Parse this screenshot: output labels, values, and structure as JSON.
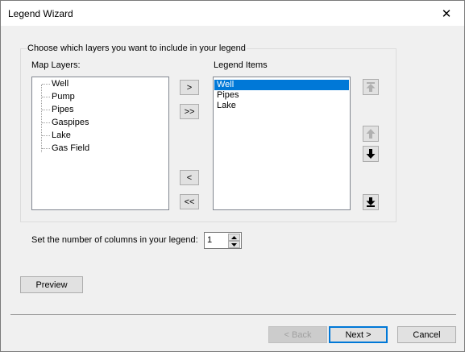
{
  "window": {
    "title": "Legend Wizard"
  },
  "group": {
    "caption": "Choose which layers you want to include in your legend",
    "map_layers_label": "Map Layers:",
    "legend_items_label": "Legend Items",
    "map_layers": [
      {
        "label": "Well"
      },
      {
        "label": "Pump"
      },
      {
        "label": "Pipes"
      },
      {
        "label": "Gaspipes"
      },
      {
        "label": "Lake"
      },
      {
        "label": "Gas Field"
      }
    ],
    "legend_items": [
      {
        "label": "Well",
        "selected": true
      },
      {
        "label": "Pipes",
        "selected": false
      },
      {
        "label": "Lake",
        "selected": false
      }
    ],
    "transfer_buttons": {
      "add": ">",
      "add_all": ">>",
      "remove": "<",
      "remove_all": "<<"
    },
    "order_buttons": {
      "move_top": "move-to-top-icon",
      "move_up": "arrow-up-icon",
      "move_down": "arrow-down-icon",
      "move_bottom": "move-to-bottom-icon"
    }
  },
  "columns": {
    "label": "Set the number of columns in your legend:",
    "value": "1"
  },
  "preview_button": "Preview",
  "footer": {
    "back": "< Back",
    "next": "Next >",
    "cancel": "Cancel"
  },
  "colors": {
    "selection": "#0078d7",
    "disabled_icon": "#b0b0b0",
    "enabled_icon": "#000000"
  }
}
